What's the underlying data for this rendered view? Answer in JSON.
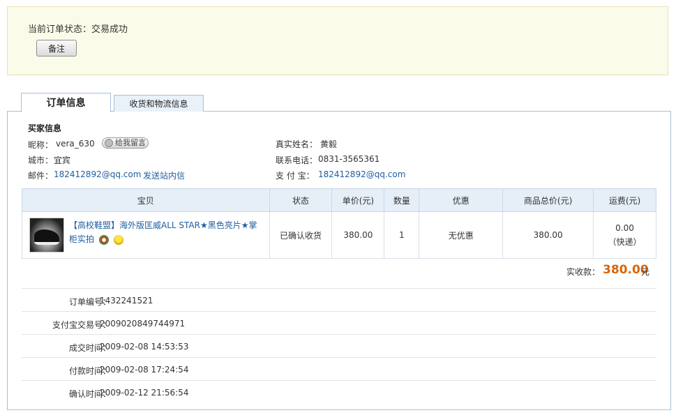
{
  "status": {
    "label": "当前订单状态：",
    "value": "交易成功",
    "note_button": "备注"
  },
  "tabs": [
    {
      "label": "订单信息",
      "active": true
    },
    {
      "label": "收货和物流信息",
      "active": false
    }
  ],
  "buyer": {
    "title": "买家信息",
    "nickname_label": "昵称：",
    "nickname": "vera_630",
    "message_button": "给我留言",
    "realname_label": "真实姓名：",
    "realname": "黄毅",
    "city_label": "城市：",
    "city": "宜宾",
    "phone_label": "联系电话：",
    "phone": "0831-3565361",
    "email_label": "邮件：",
    "email": "182412892@qq.com",
    "send_msg_link": "发送站内信",
    "alipay_label": "支 付 宝：",
    "alipay": "182412892@qq.com"
  },
  "order_table": {
    "headers": [
      "宝贝",
      "状态",
      "单价(元)",
      "数量",
      "优惠",
      "商品总价(元)",
      "运费(元)"
    ],
    "row": {
      "product": "【高校鞋盟】海外版匡威ALL STAR★黑色亮片★掌柜实拍",
      "status": "已确认收货",
      "unit_price": "380.00",
      "quantity": "1",
      "discount": "无优惠",
      "total": "380.00",
      "shipping_fee": "0.00",
      "shipping_method": "（快递）"
    }
  },
  "payment": {
    "label": "实收款：",
    "amount": "380.00",
    "unit": "元"
  },
  "details": [
    {
      "label": "订单编号：",
      "value": "1432241521"
    },
    {
      "label": "支付宝交易号：",
      "value": "2009020849744971"
    },
    {
      "label": "成交时间：",
      "value": "2009-02-08 14:53:53"
    },
    {
      "label": "付款时间：",
      "value": "2009-02-08 17:24:54"
    },
    {
      "label": "确认时间：",
      "value": "2009-02-12 21:56:54"
    }
  ],
  "colors": {
    "accent_orange": "#d9660a",
    "link_blue": "#1f5fa0",
    "status_bg": "#fbfbe9",
    "border_blue": "#a7bfd9"
  }
}
